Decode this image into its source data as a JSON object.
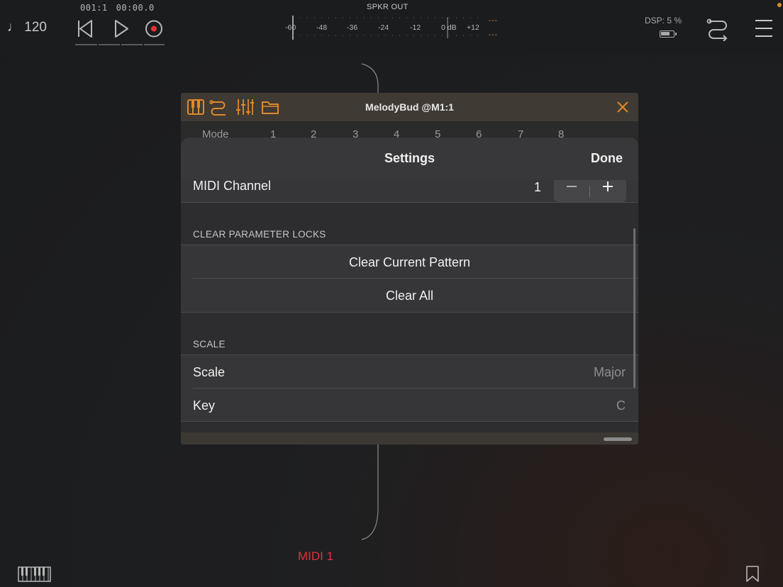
{
  "header": {
    "tempo": "♩ 120",
    "position": "001:1",
    "time": "00:00.0",
    "output_label": "SPKR OUT",
    "meter_scale": [
      "-60",
      "-48",
      "-36",
      "-24",
      "-12",
      "0 dB",
      "+12"
    ],
    "peak_left": "---",
    "peak_right": "---",
    "dsp": "DSP:  5 %",
    "battery_level": 0.75,
    "accent_color": "#e0892a"
  },
  "plugin": {
    "title": "MelodyBud @M1:1",
    "toolbar_icons": [
      "keyboard-icon",
      "routing-icon",
      "mixer-icon",
      "folder-icon"
    ],
    "pattern_header": [
      "Mode",
      "1",
      "2",
      "3",
      "4",
      "5",
      "6",
      "7",
      "8"
    ]
  },
  "settings": {
    "title": "Settings",
    "done_label": "Done",
    "midi_channel": {
      "label": "MIDI Channel",
      "value": "1",
      "minus": "−",
      "plus": "+"
    },
    "clear_section": "CLEAR PARAMETER LOCKS",
    "clear_current": "Clear Current Pattern",
    "clear_all": "Clear All",
    "scale_section": "SCALE",
    "scale": {
      "label": "Scale",
      "value": "Major"
    },
    "key": {
      "label": "Key",
      "value": "C"
    }
  },
  "footer": {
    "track_label": "MIDI 1",
    "track_color": "#e0323c"
  }
}
